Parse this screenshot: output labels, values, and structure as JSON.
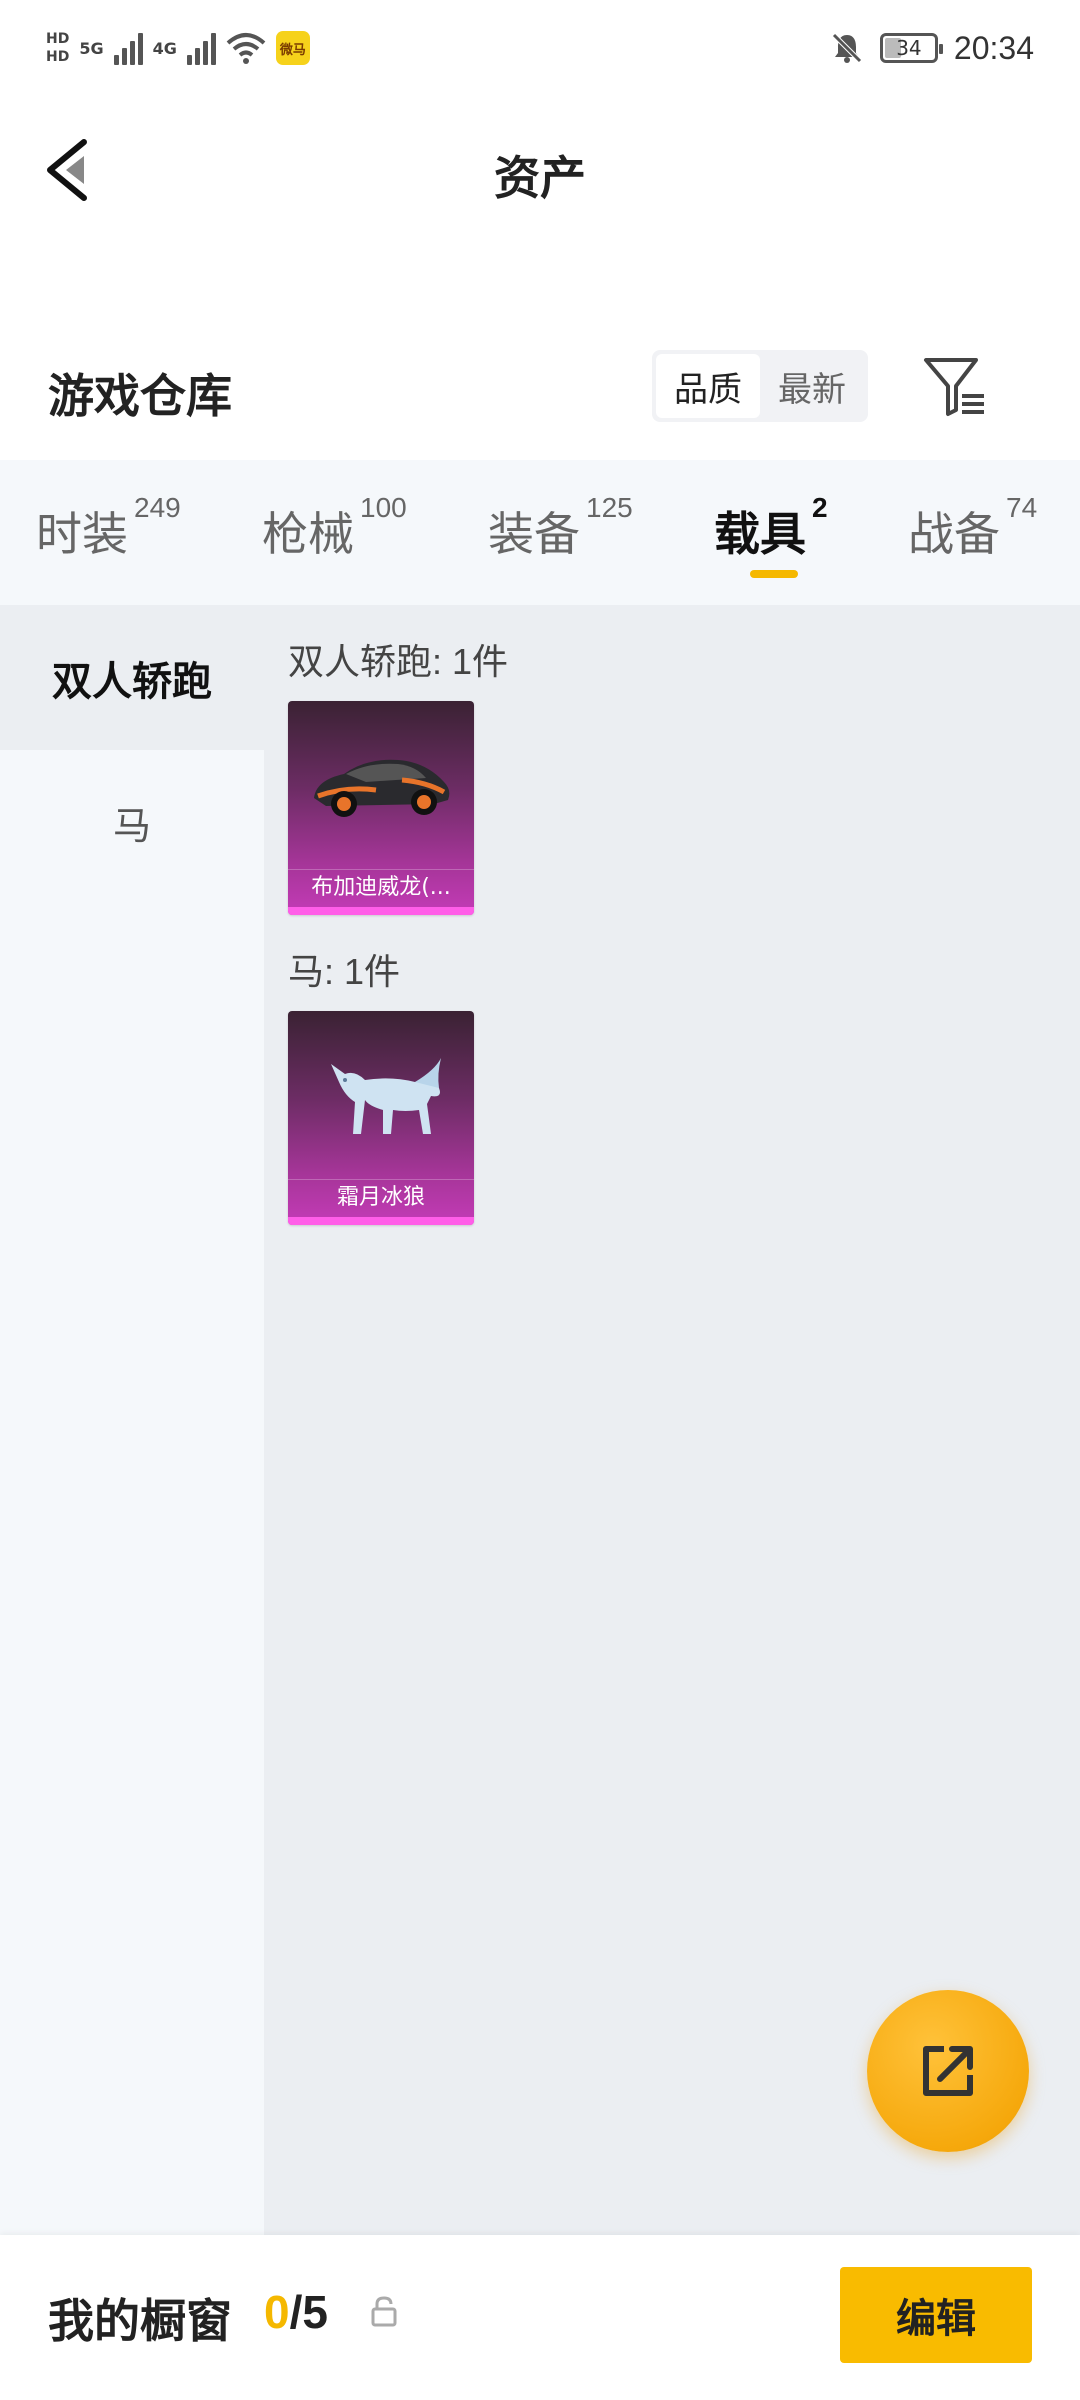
{
  "status_bar": {
    "sim1": "HD",
    "sim2": "HD",
    "net1": "5G",
    "net2": "4G",
    "app_badge": "微马",
    "battery": "34",
    "battery_level": 0.34,
    "time": "20:34"
  },
  "header": {
    "title": "资产",
    "back_icon": "chevron-left-icon"
  },
  "warehouse": {
    "title": "游戏仓库",
    "sort_options": [
      "品质",
      "最新"
    ],
    "selected_sort": "品质",
    "filter_icon": "filter-icon"
  },
  "tabs": [
    {
      "label": "时装",
      "count": "249"
    },
    {
      "label": "枪械",
      "count": "100"
    },
    {
      "label": "装备",
      "count": "125"
    },
    {
      "label": "载具",
      "count": "2"
    },
    {
      "label": "战备",
      "count": "74"
    }
  ],
  "active_tab": "载具",
  "sidebar": {
    "items": [
      {
        "label": "双人轿跑"
      },
      {
        "label": "马"
      }
    ],
    "active": "双人轿跑"
  },
  "groups": [
    {
      "title": "双人轿跑: 1件",
      "items": [
        {
          "name": "布加迪威龙(...",
          "icon": "sports-car-icon"
        }
      ]
    },
    {
      "title": "马: 1件",
      "items": [
        {
          "name": "霜月冰狼",
          "icon": "ice-wolf-icon"
        }
      ]
    }
  ],
  "fab": {
    "icon": "share-external-icon"
  },
  "showcase": {
    "title": "我的橱窗",
    "current": "0",
    "separator": "/",
    "max": "5",
    "lock_icon": "lock-icon",
    "edit_label": "编辑"
  },
  "colors": {
    "accent": "#f5b800",
    "card_purple": "#a43597",
    "card_strip": "#ff5ee8"
  }
}
